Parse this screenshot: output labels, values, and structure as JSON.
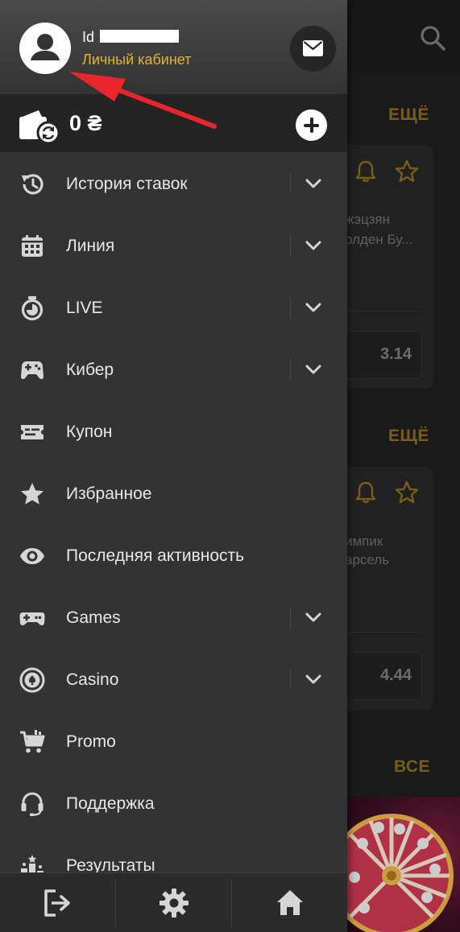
{
  "profile": {
    "id_label": "Id",
    "cabinet_link": "Личный кабинет",
    "avatar_icon": "user-avatar-icon",
    "mail_icon": "envelope-icon"
  },
  "balance": {
    "value": "0 ₴",
    "wallet_icon": "wallet-refresh-icon",
    "add_icon": "plus-circle-icon"
  },
  "menu": {
    "items": [
      {
        "label": "История ставок",
        "icon": "history-icon",
        "expandable": true
      },
      {
        "label": "Линия",
        "icon": "calendar-icon",
        "expandable": true
      },
      {
        "label": "LIVE",
        "icon": "stopwatch-icon",
        "expandable": true
      },
      {
        "label": "Кибер",
        "icon": "gamepad-icon",
        "expandable": true
      },
      {
        "label": "Купон",
        "icon": "coupon-icon",
        "expandable": false
      },
      {
        "label": "Избранное",
        "icon": "star-icon",
        "expandable": false
      },
      {
        "label": "Последняя активность",
        "icon": "eye-icon",
        "expandable": false
      },
      {
        "label": "Games",
        "icon": "gamepad-icon",
        "expandable": true
      },
      {
        "label": "Casino",
        "icon": "casino-chip-icon",
        "expandable": true
      },
      {
        "label": "Promo",
        "icon": "shopping-cart-icon",
        "expandable": false
      },
      {
        "label": "Поддержка",
        "icon": "headset-icon",
        "expandable": false
      },
      {
        "label": "Результаты",
        "icon": "podium-icon",
        "expandable": false
      }
    ]
  },
  "bottom_bar": {
    "items": [
      {
        "icon": "logout-icon"
      },
      {
        "icon": "gear-icon"
      },
      {
        "icon": "home-icon"
      }
    ]
  },
  "background": {
    "more_label_1": "ЕЩЁ",
    "more_label_2": "ЕЩЁ",
    "all_label": "ВСЕ",
    "card1_team1": "жэцзян",
    "card1_team2": "олден Бу...",
    "card1_odd": "3.14",
    "card2_team1": "импик",
    "card2_team2": "арсель",
    "card2_odd": "4.44"
  },
  "colors": {
    "accent": "#e5b526",
    "drawer_bg": "#333333",
    "annotation_arrow": "#e8262b"
  }
}
